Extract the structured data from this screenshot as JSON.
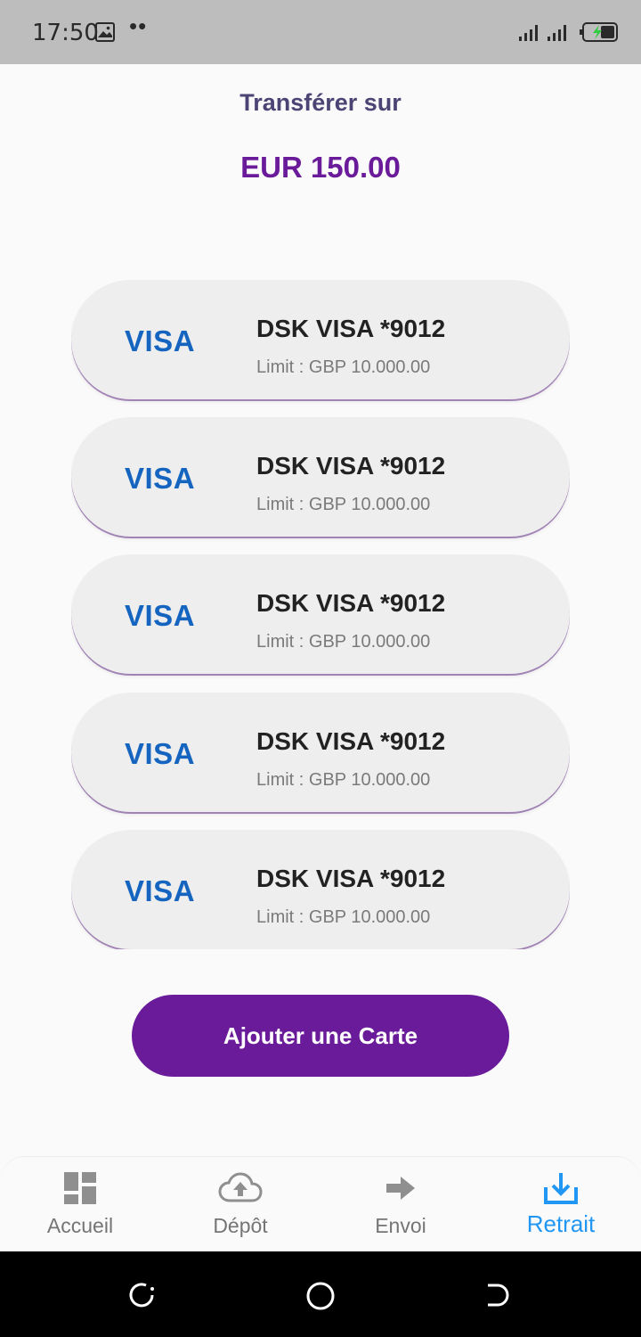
{
  "status_bar": {
    "time": "17:50",
    "dots": "••"
  },
  "header": {
    "title": "Transférer sur",
    "amount": "EUR 150.00"
  },
  "cards": [
    {
      "brand": "VISA",
      "name": "DSK VISA *9012",
      "limit": "Limit : GBP 10.000.00"
    },
    {
      "brand": "VISA",
      "name": "DSK VISA *9012",
      "limit": "Limit : GBP 10.000.00"
    },
    {
      "brand": "VISA",
      "name": "DSK VISA *9012",
      "limit": "Limit : GBP 10.000.00"
    },
    {
      "brand": "VISA",
      "name": "DSK VISA *9012",
      "limit": "Limit : GBP 10.000.00"
    },
    {
      "brand": "VISA",
      "name": "DSK VISA *9012",
      "limit": "Limit : GBP 10.000.00"
    }
  ],
  "add_card_label": "Ajouter une Carte",
  "bottom_nav": [
    {
      "label": "Accueil",
      "icon": "dashboard-icon",
      "active": false
    },
    {
      "label": "Dépôt",
      "icon": "cloud-upload-icon",
      "active": false
    },
    {
      "label": "Envoi",
      "icon": "arrow-right-icon",
      "active": false
    },
    {
      "label": "Retrait",
      "icon": "download-icon",
      "active": true
    }
  ],
  "colors": {
    "primary": "#6a1b9a",
    "visa": "#1565c0",
    "active_nav": "#2196f3",
    "title": "#4b4474"
  }
}
